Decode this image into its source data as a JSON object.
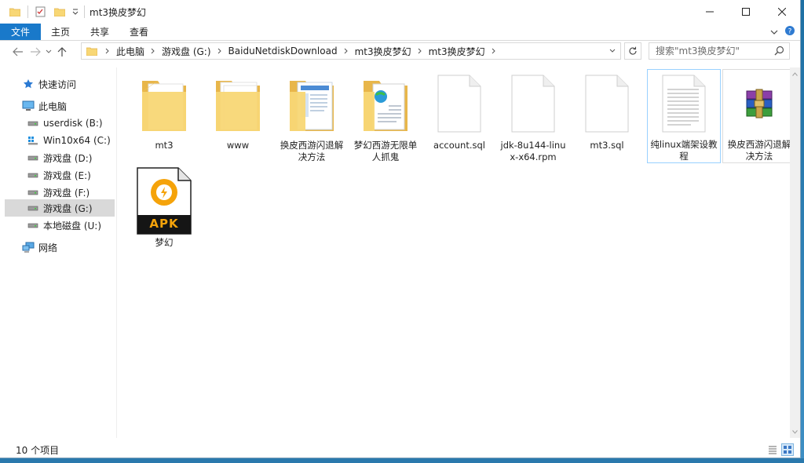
{
  "window": {
    "title": "mt3换皮梦幻",
    "controls": {
      "minimize": "minimize",
      "maximize": "maximize",
      "close": "close"
    }
  },
  "ribbon": {
    "tabs": [
      {
        "label": "文件",
        "active": true
      },
      {
        "label": "主页"
      },
      {
        "label": "共享"
      },
      {
        "label": "查看"
      }
    ]
  },
  "address": {
    "breadcrumbs": [
      "此电脑",
      "游戏盘 (G:)",
      "BaiduNetdiskDownload",
      "mt3换皮梦幻",
      "mt3换皮梦幻"
    ]
  },
  "search": {
    "placeholder": "搜索\"mt3换皮梦幻\""
  },
  "sidebar": {
    "items": [
      {
        "label": "快速访问",
        "icon": "star-icon"
      },
      {
        "label": "此电脑",
        "icon": "computer-icon"
      },
      {
        "label": "userdisk (B:)",
        "icon": "drive-icon"
      },
      {
        "label": "Win10x64 (C:)",
        "icon": "system-drive-icon"
      },
      {
        "label": "游戏盘 (D:)",
        "icon": "drive-icon"
      },
      {
        "label": "游戏盘 (E:)",
        "icon": "drive-icon"
      },
      {
        "label": "游戏盘 (F:)",
        "icon": "drive-icon"
      },
      {
        "label": "游戏盘 (G:)",
        "icon": "drive-icon",
        "selected": true
      },
      {
        "label": "本地磁盘 (U:)",
        "icon": "drive-icon"
      },
      {
        "label": "网络",
        "icon": "network-icon"
      }
    ]
  },
  "files": [
    {
      "name": "mt3",
      "type": "folder"
    },
    {
      "name": "www",
      "type": "folder"
    },
    {
      "name": "换皮西游闪退解决方法",
      "type": "folder-doc"
    },
    {
      "name": "梦幻西游无限单人抓鬼",
      "type": "folder-web"
    },
    {
      "name": "account.sql",
      "type": "file"
    },
    {
      "name": "jdk-8u144-linux-x64.rpm",
      "type": "file"
    },
    {
      "name": "mt3.sql",
      "type": "file"
    },
    {
      "name": "纯linux端架设教程",
      "type": "text",
      "hovered": true
    },
    {
      "name": "换皮西游闪退解决方法",
      "type": "rar"
    },
    {
      "name": "梦幻",
      "type": "apk",
      "badge": "APK"
    }
  ],
  "status": {
    "item_count": "10 个项目"
  },
  "colors": {
    "accent": "#1979ca",
    "folder": "#f8d775",
    "folder_dark": "#e8b64a",
    "selection": "#d9d9d9",
    "hover": "#99d1ff",
    "apk_orange": "#f5a30a"
  }
}
